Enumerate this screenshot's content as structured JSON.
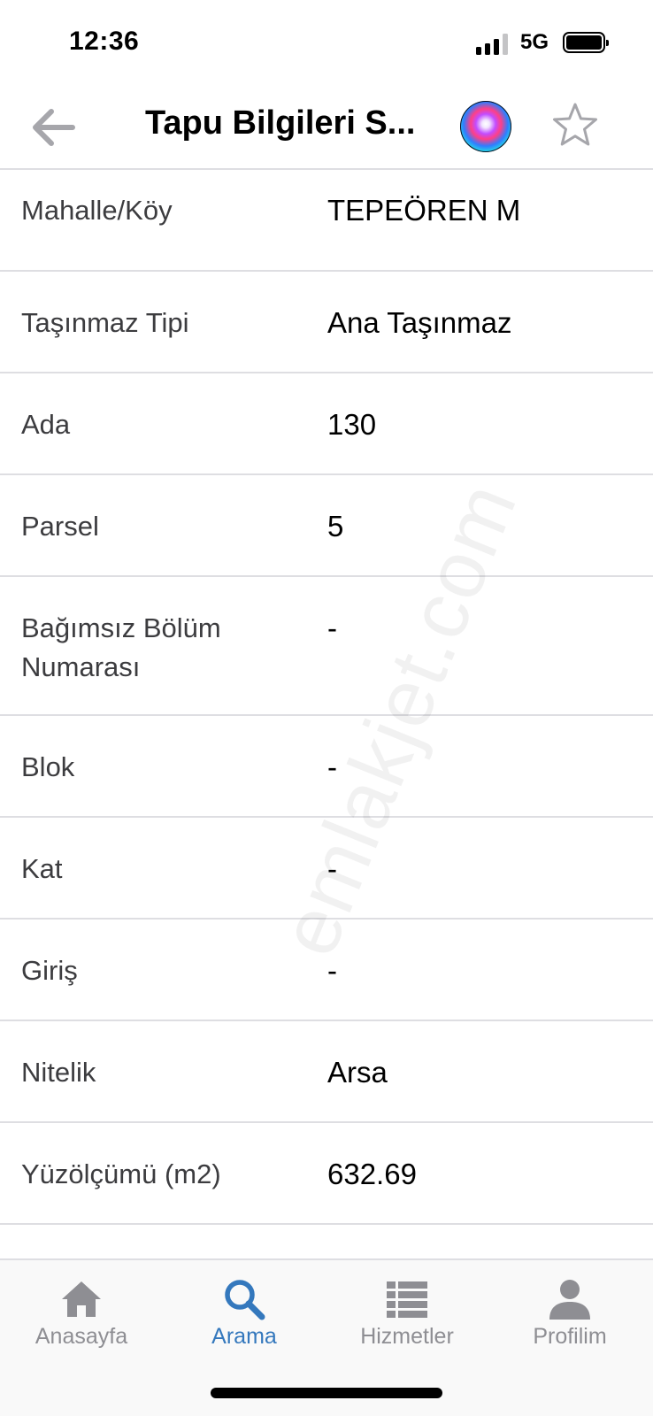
{
  "status_bar": {
    "time": "12:36",
    "network": "5G",
    "signal_bars_filled": 3,
    "signal_bars_total": 4,
    "battery_icon": "battery-full-icon"
  },
  "header": {
    "title": "Tapu Bilgileri S...",
    "back_icon": "arrow-left-icon",
    "assistant_icon": "siri-icon",
    "favorite_icon": "star-outline-icon"
  },
  "rows": [
    {
      "label": "Mahalle/Köy",
      "value": "TEPEÖREN M"
    },
    {
      "label": "Taşınmaz Tipi",
      "value": "Ana Taşınmaz"
    },
    {
      "label": "Ada",
      "value": "130"
    },
    {
      "label": "Parsel",
      "value": "5"
    },
    {
      "label": "Bağımsız Bölüm",
      "label_line2": "Numarası",
      "value": "-"
    },
    {
      "label": "Blok",
      "value": "-"
    },
    {
      "label": "Kat",
      "value": "-"
    },
    {
      "label": "Giriş",
      "value": "-"
    },
    {
      "label": "Nitelik",
      "value": "Arsa"
    },
    {
      "label": "Yüzölçümü (m2)",
      "value": "632.69"
    }
  ],
  "watermark": "emlakjet.com",
  "tabs": [
    {
      "label": "Anasayfa",
      "icon": "home-icon",
      "active": false
    },
    {
      "label": "Arama",
      "icon": "search-icon",
      "active": true
    },
    {
      "label": "Hizmetler",
      "icon": "list-icon",
      "active": false
    },
    {
      "label": "Profilim",
      "icon": "person-icon",
      "active": false
    }
  ],
  "colors": {
    "accent": "#3478bd",
    "inactive": "#8e8e93",
    "divider": "#dedee2",
    "back_arrow": "#a6a6ab"
  }
}
